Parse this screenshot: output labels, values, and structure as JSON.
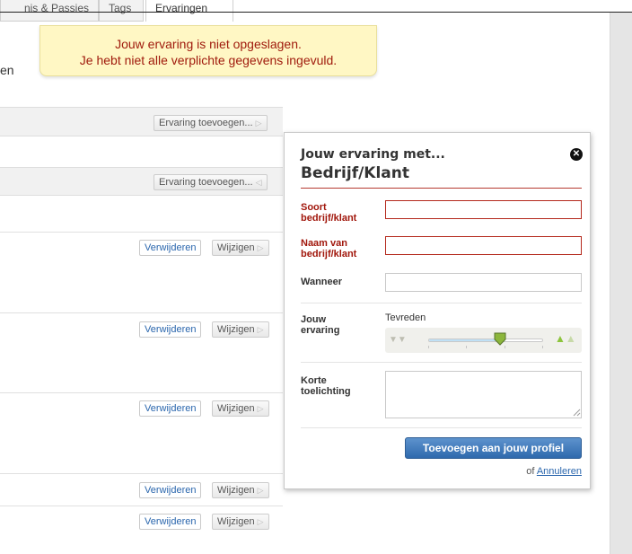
{
  "tabs": [
    {
      "label": "nis & Passies"
    },
    {
      "label": "Tags"
    },
    {
      "label": "Ervaringen"
    }
  ],
  "warning": {
    "line1": "Jouw ervaring is niet opgeslagen.",
    "line2": "Je hebt niet alle verplichte gegevens ingevuld."
  },
  "side_text": "en",
  "list": {
    "add_label": "Ervaring toevoegen...",
    "delete_label": "Verwijderen",
    "edit_label": "Wijzigen"
  },
  "popup": {
    "title_line1": "Jouw ervaring met...",
    "title_line2": "Bedrijf/Klant",
    "fields": {
      "soort_label_1": "Soort",
      "soort_label_2": "bedrijf/klant",
      "naam_label_1": "Naam van",
      "naam_label_2": "bedrijf/klant",
      "wanneer_label": "Wanneer",
      "ervaring_label_1": "Jouw",
      "ervaring_label_2": "ervaring",
      "toelichting_label_1": "Korte",
      "toelichting_label_2": "toelichting"
    },
    "rating": {
      "label": "Tevreden",
      "level": 0.625
    },
    "submit_label": "Toevoegen aan jouw profiel",
    "cancel_prefix": "of",
    "cancel_label": "Annuleren"
  },
  "colors": {
    "error_red": "#a1170c",
    "warning_bg": "#fff7c4",
    "link_blue": "#2a66ad",
    "button_blue": "#2f69ad",
    "thumb_green": "#8cc43c"
  },
  "icons": {
    "close": "close-icon",
    "thumbs_down": "thumbs-down-icon",
    "thumbs_up": "thumbs-up-icon",
    "slider_thumb": "slider-thumb-icon",
    "arrow": "arrow-right-icon"
  }
}
